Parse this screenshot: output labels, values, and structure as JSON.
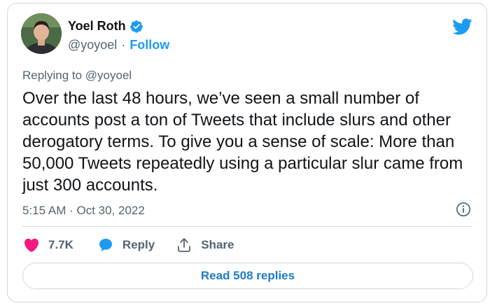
{
  "author": {
    "name": "Yoel Roth",
    "handle": "@yoyoel",
    "separator": "·",
    "follow_label": "Follow"
  },
  "tweet": {
    "replying_to": "Replying to @yoyoel",
    "text": "Over the last 48 hours, we’ve seen a small number of accounts post a ton of Tweets that include slurs and other derogatory terms. To give you a sense of scale: More than 50,000 Tweets repeatedly using a particular slur came from just 300 accounts.",
    "timestamp": "5:15 AM · Oct 30, 2022"
  },
  "actions": {
    "likes": "7.7K",
    "reply_label": "Reply",
    "share_label": "Share",
    "read_replies_label": "Read 508 replies"
  },
  "colors": {
    "accent": "#1d9bf0",
    "like": "#f91880",
    "text_primary": "#0f1419",
    "text_secondary": "#536471",
    "border": "#cfd9de"
  },
  "icons": [
    "verified-badge-icon",
    "twitter-bird-icon",
    "info-icon",
    "heart-icon",
    "reply-bubble-icon",
    "share-icon"
  ]
}
